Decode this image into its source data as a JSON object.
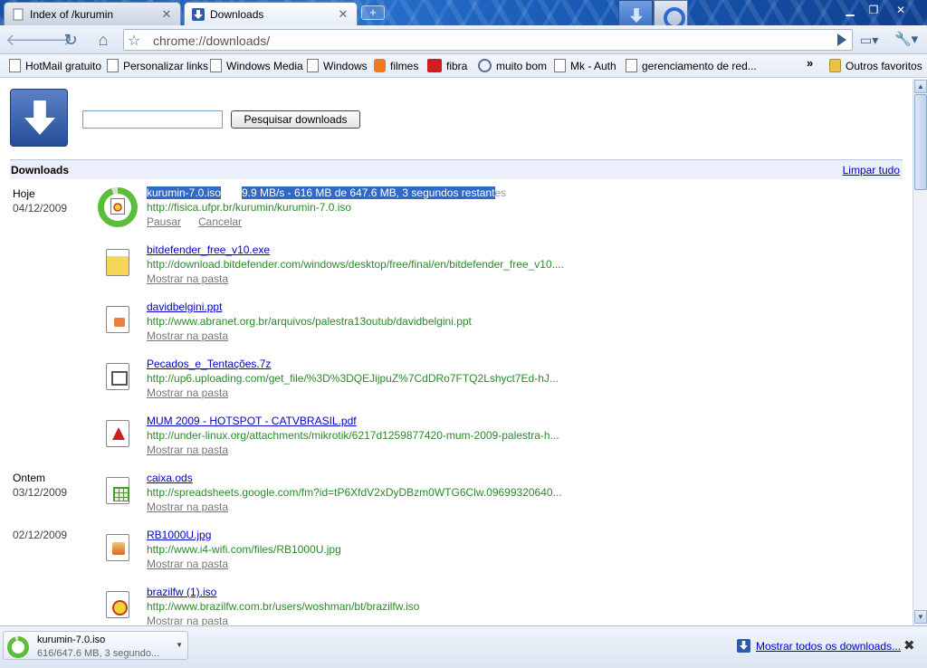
{
  "tabs": [
    {
      "label": "Index of /kurumin",
      "active": false
    },
    {
      "label": "Downloads",
      "active": true
    }
  ],
  "toolbar": {
    "url": "chrome://downloads/",
    "icons": [
      "back-icon",
      "forward-icon",
      "reload-icon",
      "home-icon",
      "star-icon",
      "go-icon",
      "page-menu-icon",
      "wrench-icon"
    ]
  },
  "bookmarks": {
    "items": [
      {
        "label": "HotMail gratuito",
        "icon": "page"
      },
      {
        "label": "Personalizar links",
        "icon": "page"
      },
      {
        "label": "Windows Media",
        "icon": "page"
      },
      {
        "label": "Windows",
        "icon": "page"
      },
      {
        "label": "filmes",
        "icon": "blogger"
      },
      {
        "label": "fibra",
        "icon": "youtube"
      },
      {
        "label": "muito bom",
        "icon": "wordpress"
      },
      {
        "label": "Mk - Auth",
        "icon": "page"
      },
      {
        "label": "gerenciamento de red...",
        "icon": "page"
      }
    ],
    "more": "»",
    "other_folder": "Outros favoritos"
  },
  "page": {
    "search_button": "Pesquisar downloads",
    "search_value": "",
    "section_title": "Downloads",
    "clear_all": "Limpar tudo"
  },
  "groups": [
    {
      "day": "Hoje",
      "date": "04/12/2009"
    },
    {
      "day": "Ontem",
      "date": "03/12/2009"
    },
    {
      "day": "",
      "date": "02/12/2009"
    }
  ],
  "downloads": [
    {
      "name": "kurumin-7.0.iso",
      "status": "9.9 MB/s - 616 MB de 647.6 MB, 3 segundos restantes",
      "status_selected": "9.9 MB/s - 616 MB de 647.6 MB, 3 segundos restant",
      "status_rest": "es",
      "url": "http://fisica.ufpr.br/kurumin/kurumin-7.0.iso",
      "actions": [
        "Pausar",
        "Cancelar"
      ],
      "progress": 0.95
    },
    {
      "name": "bitdefender_free_v10.exe",
      "url": "http://download.bitdefender.com/windows/desktop/free/final/en/bitdefender_free_v10....",
      "action": "Mostrar na pasta",
      "icon": "exe"
    },
    {
      "name": "davidbelgini.ppt",
      "url": "http://www.abranet.org.br/arquivos/palestra13outub/davidbelgini.ppt",
      "action": "Mostrar na pasta",
      "icon": "ppt"
    },
    {
      "name": "Pecados_e_Tentações.7z",
      "url": "http://up6.uploading.com/get_file/%3D%3DQEJijpuZ%7CdDRo7FTQ2Lshyct7Ed-hJ...",
      "action": "Mostrar na pasta",
      "icon": "7z"
    },
    {
      "name": "MUM 2009 - HOTSPOT - CATVBRASIL.pdf",
      "url": "http://under-linux.org/attachments/mikrotik/6217d1259877420-mum-2009-palestra-h...",
      "action": "Mostrar na pasta",
      "icon": "pdf"
    },
    {
      "name": "caixa.ods",
      "url": "http://spreadsheets.google.com/fm?id=tP6XfdV2xDyDBzm0WTG6Clw.09699320640...",
      "action": "Mostrar na pasta",
      "icon": "ods"
    },
    {
      "name": "RB1000U.jpg",
      "url": "http://www.i4-wifi.com/files/RB1000U.jpg",
      "action": "Mostrar na pasta",
      "icon": "jpg"
    },
    {
      "name": "brazilfw (1).iso",
      "url": "http://www.brazilfw.com.br/users/woshman/bt/brazilfw.iso",
      "action": "Mostrar na pasta",
      "icon": "iso"
    }
  ],
  "shelf": {
    "item_name": "kurumin-7.0.iso",
    "item_status": "616/647.6 MB, 3 segundo...",
    "show_all": "Mostrar todos os downloads...",
    "close": "✖"
  },
  "colors": {
    "link": "#0000cc",
    "url_green": "#2b8a2b",
    "selection": "#3169c6",
    "progress": "#5bbd3a"
  }
}
